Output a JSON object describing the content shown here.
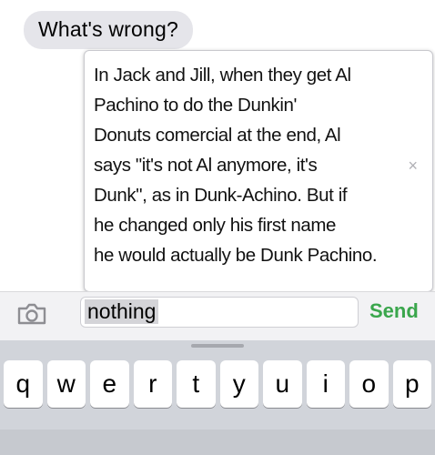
{
  "thread": {
    "received_message": "What's wrong?"
  },
  "autocorrect_popup": {
    "lines": [
      "In Jack and Jill, when they get Al",
      "Pachino to do the Dunkin'",
      "Donuts comercial at the end, Al",
      "says \"it's not Al anymore, it's",
      "Dunk\", as in Dunk-Achino. But if",
      "he changed only his first name",
      "he would actually be Dunk Pachino."
    ],
    "close_symbol": "×"
  },
  "composer": {
    "camera_icon": "camera-icon",
    "input_value": "nothing",
    "send_label": "Send",
    "send_color": "#3aa64c"
  },
  "keyboard": {
    "top_row": [
      "q",
      "w",
      "e",
      "r",
      "t",
      "y",
      "u",
      "i",
      "o",
      "p"
    ]
  }
}
